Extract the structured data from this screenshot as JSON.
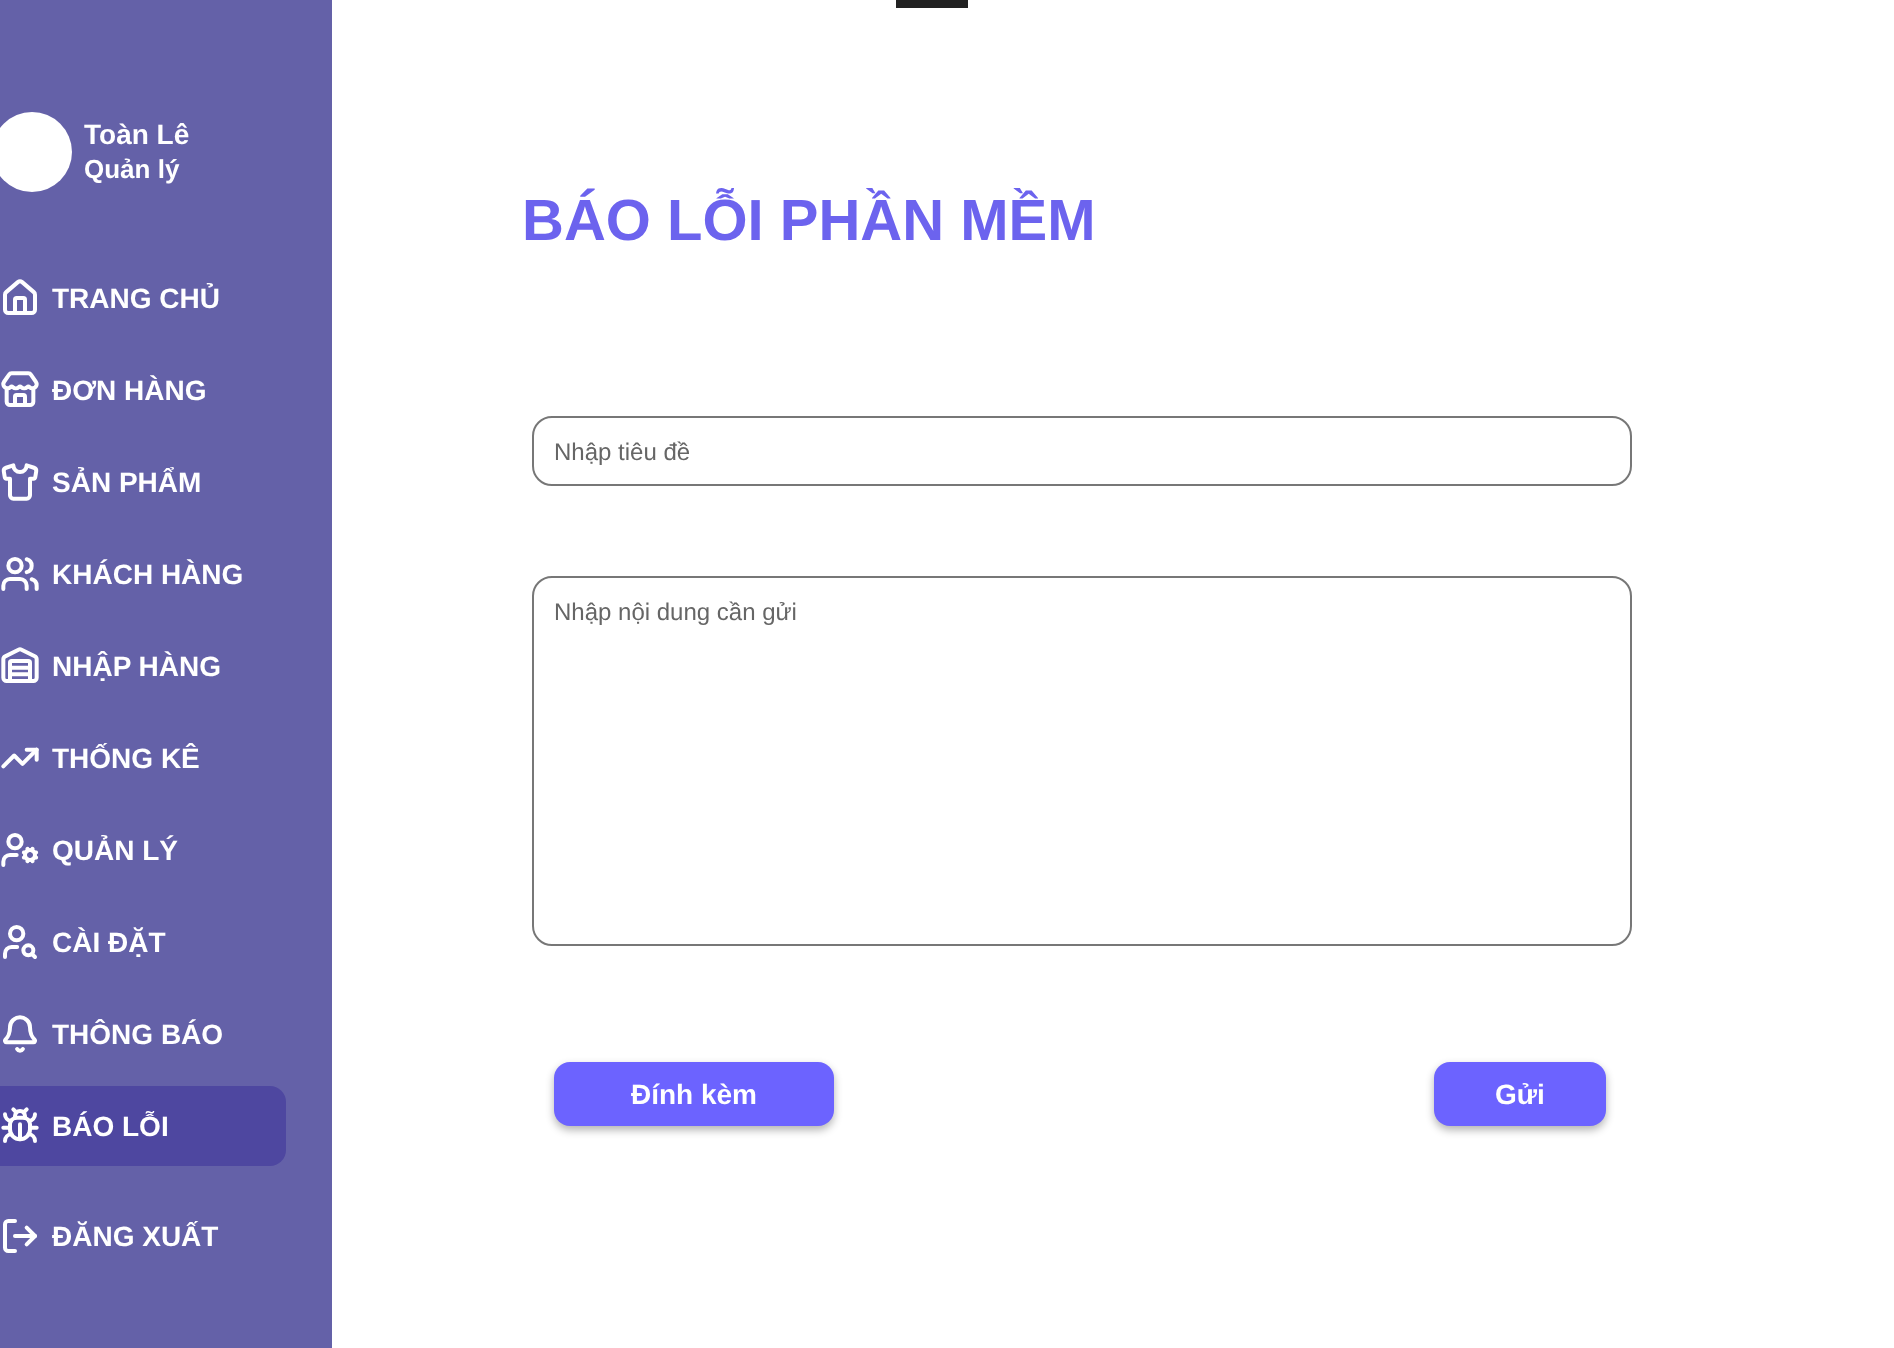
{
  "user": {
    "name": "Toàn Lê",
    "role": "Quản lý"
  },
  "sidebar": {
    "items": [
      {
        "kind": "home",
        "label": "TRANG CHỦ",
        "selected": false
      },
      {
        "kind": "orders",
        "label": "ĐƠN HÀNG",
        "selected": false
      },
      {
        "kind": "products",
        "label": "SẢN PHẨM",
        "selected": false
      },
      {
        "kind": "customers",
        "label": "KHÁCH HÀNG",
        "selected": false
      },
      {
        "kind": "import",
        "label": "NHẬP HÀNG",
        "selected": false
      },
      {
        "kind": "stats",
        "label": "THỐNG KÊ",
        "selected": false
      },
      {
        "kind": "manage",
        "label": "QUẢN LÝ",
        "selected": false
      },
      {
        "kind": "settings",
        "label": "CÀI ĐẶT",
        "selected": false
      },
      {
        "kind": "notifications",
        "label": "THÔNG BÁO",
        "selected": false
      },
      {
        "kind": "bugs",
        "label": "BÁO LỖI",
        "selected": true
      }
    ],
    "logout": "ĐĂNG XUẤT"
  },
  "page": {
    "title": "BÁO LỖI PHẦN MỀM",
    "title_field": {
      "placeholder": "Nhập tiêu đề"
    },
    "content_field": {
      "placeholder": "Nhập nội dung cần gửi"
    },
    "buttons": [
      "Đính kèm",
      "Gửi"
    ]
  }
}
